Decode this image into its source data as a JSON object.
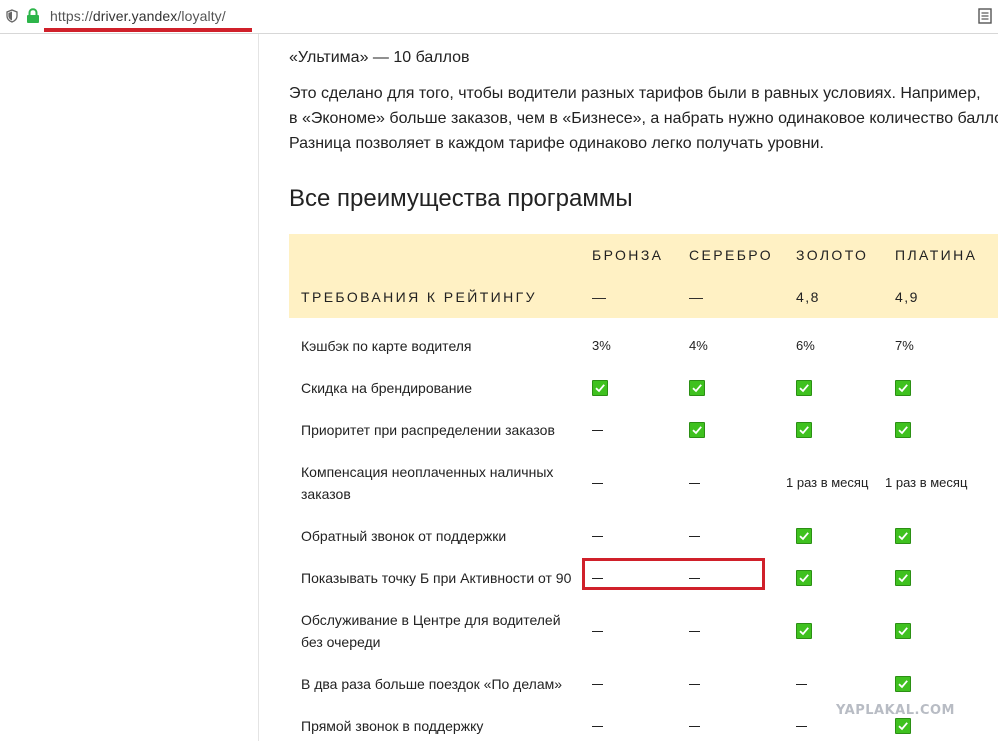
{
  "browser": {
    "url_prefix": "https://",
    "url_host": "driver.yandex",
    "url_path": "/loyalty/"
  },
  "intro": {
    "tariff_line": "«Ультима» — 10 баллов",
    "paragraph": [
      "Это сделано для того, чтобы водители разных тарифов были в равных условиях. Например,",
      "в «Экономе» больше заказов, чем в «Бизнесе», а набрать нужно одинаковое количество балло",
      "Разница позволяет в каждом тарифе одинаково легко получать уровни."
    ]
  },
  "section_title": "Все преимущества программы",
  "table": {
    "levels": [
      "БРОНЗА",
      "СЕРЕБРО",
      "ЗОЛОТО",
      "ПЛАТИНА"
    ],
    "requirement_label": "ТРЕБОВАНИЯ К РЕЙТИНГУ",
    "requirement_values": [
      "—",
      "—",
      "4,8",
      "4,9"
    ],
    "rows": [
      {
        "feature": [
          "Кэшбэк по карте водителя"
        ],
        "values": [
          "3%",
          "4%",
          "6%",
          "7%"
        ]
      },
      {
        "feature": [
          "Скидка на брендирование"
        ],
        "values": [
          "check",
          "check",
          "check",
          "check"
        ]
      },
      {
        "feature": [
          "Приоритет при распределении заказов"
        ],
        "values": [
          "dash",
          "check",
          "check",
          "check"
        ]
      },
      {
        "feature": [
          "Компенсация неоплаченных наличных",
          "заказов"
        ],
        "values": [
          "dash",
          "dash",
          "1 раз в месяц",
          "1 раз в месяц"
        ]
      },
      {
        "feature": [
          "Обратный звонок от поддержки"
        ],
        "values": [
          "dash",
          "dash",
          "check",
          "check"
        ]
      },
      {
        "feature": [
          "Показывать точку Б при Активности от 90"
        ],
        "values": [
          "dash",
          "dash",
          "check",
          "check"
        ]
      },
      {
        "feature": [
          "Обслуживание в Центре для водителей",
          "без очереди"
        ],
        "values": [
          "dash",
          "dash",
          "check",
          "check"
        ]
      },
      {
        "feature": [
          "В два раза больше поездок «По делам»"
        ],
        "values": [
          "dash",
          "dash",
          "dash",
          "check"
        ]
      },
      {
        "feature": [
          "Прямой звонок в поддержку"
        ],
        "values": [
          "dash",
          "dash",
          "dash",
          "check"
        ]
      }
    ]
  },
  "watermark": "YAPLAKAL.COM",
  "icons": {
    "shield": "shield-icon",
    "lock": "lock-icon",
    "reader": "reader-view-icon",
    "check": "checkmark-icon"
  },
  "colors": {
    "header_bg": "#fff1c4",
    "check": "#3fc11f",
    "annotation": "#d0202a",
    "lock": "#2db54a"
  }
}
